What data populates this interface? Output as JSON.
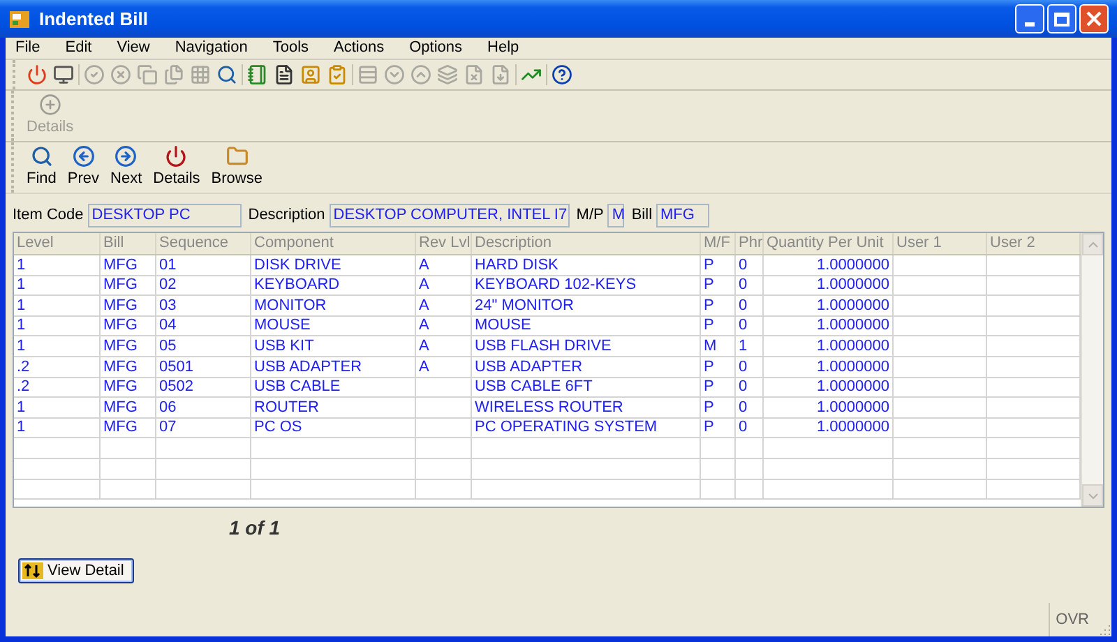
{
  "window": {
    "title": "Indented Bill"
  },
  "menu": [
    "File",
    "Edit",
    "View",
    "Navigation",
    "Tools",
    "Actions",
    "Options",
    "Help"
  ],
  "toolbar": [
    [
      {
        "disabled": false
      },
      {
        "disabled": false
      }
    ],
    [
      {
        "disabled": true
      },
      {
        "disabled": true
      },
      {
        "disabled": true
      },
      {
        "disabled": true
      },
      {
        "disabled": true
      },
      {
        "disabled": false
      }
    ],
    [
      {
        "disabled": false
      },
      {
        "disabled": false
      },
      {
        "disabled": false
      },
      {
        "disabled": false
      }
    ],
    [
      {
        "disabled": true
      },
      {
        "disabled": true
      },
      {
        "disabled": true
      },
      {
        "disabled": true
      },
      {
        "disabled": true
      },
      {
        "disabled": true
      }
    ],
    [
      {
        "disabled": false
      }
    ],
    [
      {
        "disabled": false
      }
    ]
  ],
  "detail_bar": [
    {
      "label": "Details",
      "disabled": true
    }
  ],
  "nav_bar": [
    {
      "label": "Find"
    },
    {
      "label": "Prev"
    },
    {
      "label": "Next"
    },
    {
      "label": "Details"
    },
    {
      "label": "Browse"
    }
  ],
  "header_fields": [
    {
      "label": "Item Code",
      "value": "DESKTOP PC",
      "kind": "wide"
    },
    {
      "label": "Description",
      "value": "DESKTOP COMPUTER, INTEL I7",
      "kind": "long"
    },
    {
      "label": "M/P",
      "value": "M",
      "kind": "tiny"
    },
    {
      "label": "Bill",
      "value": "MFG",
      "kind": "short"
    }
  ],
  "table": {
    "columns": [
      "Level",
      "Bill",
      "Sequence",
      "Component",
      "Rev Lvl",
      "Description",
      "M/F",
      "Phr",
      "Quantity Per Unit",
      "User 1",
      "User 2"
    ],
    "rows": [
      [
        "1",
        "MFG",
        "01",
        "DISK DRIVE",
        "A",
        "HARD DISK",
        "P",
        "0",
        "1.0000000"
      ],
      [
        "1",
        "MFG",
        "02",
        "KEYBOARD",
        "A",
        "KEYBOARD 102-KEYS",
        "P",
        "0",
        "1.0000000"
      ],
      [
        "1",
        "MFG",
        "03",
        "MONITOR",
        "A",
        "24\" MONITOR",
        "P",
        "0",
        "1.0000000"
      ],
      [
        "1",
        "MFG",
        "04",
        "MOUSE",
        "A",
        "MOUSE",
        "P",
        "0",
        "1.0000000"
      ],
      [
        "1",
        "MFG",
        "05",
        "USB KIT",
        "A",
        "USB FLASH DRIVE",
        "M",
        "1",
        "1.0000000"
      ],
      [
        ".2",
        "MFG",
        "0501",
        "USB ADAPTER",
        "A",
        "USB ADAPTER",
        "P",
        "0",
        "1.0000000"
      ],
      [
        ".2",
        "MFG",
        "0502",
        "USB CABLE",
        "",
        "USB CABLE 6FT",
        "P",
        "0",
        "1.0000000"
      ],
      [
        "1",
        "MFG",
        "06",
        "ROUTER",
        "",
        "WIRELESS ROUTER",
        "P",
        "0",
        "1.0000000"
      ],
      [
        "1",
        "MFG",
        "07",
        "PC OS",
        "",
        "PC OPERATING SYSTEM",
        "P",
        "0",
        "1.0000000"
      ]
    ]
  },
  "pager": "1 of 1",
  "view_detail_button": "View Detail",
  "status_bar": {
    "mode": "OVR"
  }
}
